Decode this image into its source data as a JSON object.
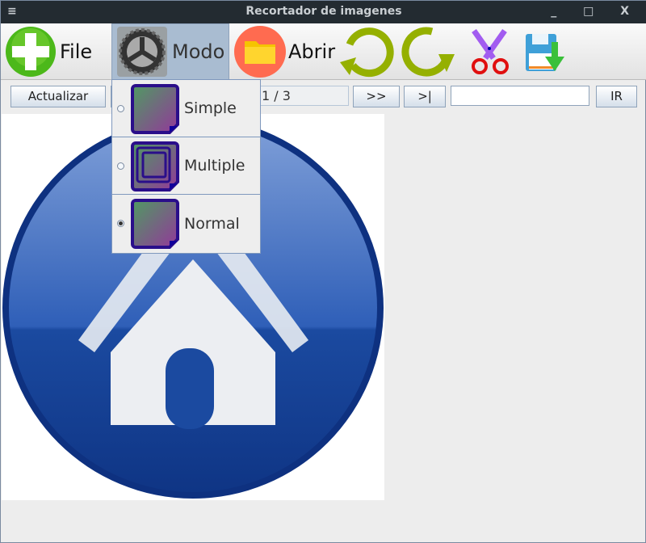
{
  "window": {
    "title": "Recortador de imagenes",
    "menu_glyph": "≡",
    "controls": "_ □ X"
  },
  "toolbar": {
    "file_label": "File",
    "modo_label": "Modo",
    "abrir_label": "Abrir"
  },
  "nav": {
    "refresh_label": "Actualizar",
    "page_indicator": "1 / 3",
    "next_label": ">>",
    "last_label": ">|",
    "goto_value": "",
    "go_label": "IR"
  },
  "modo_menu": {
    "items": [
      {
        "label": "Simple",
        "selected": false
      },
      {
        "label": "Multiple",
        "selected": false
      },
      {
        "label": "Normal",
        "selected": true
      }
    ]
  },
  "colors": {
    "accent": "#a9bcd1",
    "home_blue": "#1b48a0"
  }
}
